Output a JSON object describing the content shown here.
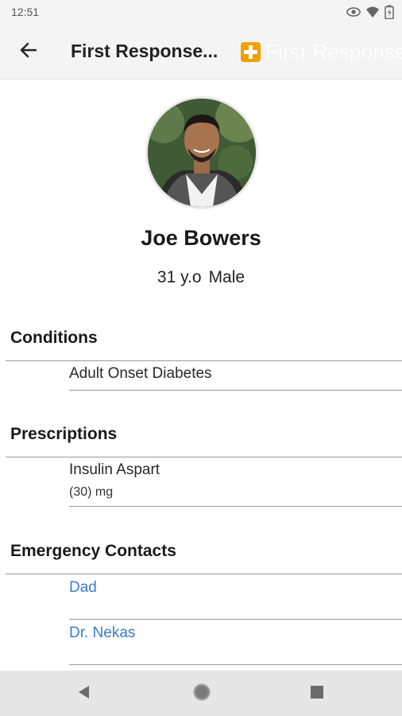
{
  "status_bar": {
    "time": "12:51",
    "icons": [
      "eye-icon",
      "wifi-icon",
      "battery-icon"
    ]
  },
  "app_bar": {
    "title": "First Response...",
    "brand_text": "First Response",
    "brand_color": "#f0a000"
  },
  "profile": {
    "name": "Joe Bowers",
    "age": "31 y.o",
    "sex": "Male"
  },
  "conditions": {
    "title": "Conditions",
    "items": [
      "Adult Onset Diabetes"
    ]
  },
  "prescriptions": {
    "title": "Prescriptions",
    "items": [
      {
        "name": "Insulin Aspart",
        "dose": "(30) mg"
      }
    ]
  },
  "emergency_contacts": {
    "title": "Emergency Contacts",
    "items": [
      "Dad",
      "Dr. Nekas"
    ],
    "link_color": "#3c7ccd"
  },
  "nav_bar": {
    "buttons": [
      "back-triangle-icon",
      "home-circle-icon",
      "recents-square-icon"
    ]
  }
}
